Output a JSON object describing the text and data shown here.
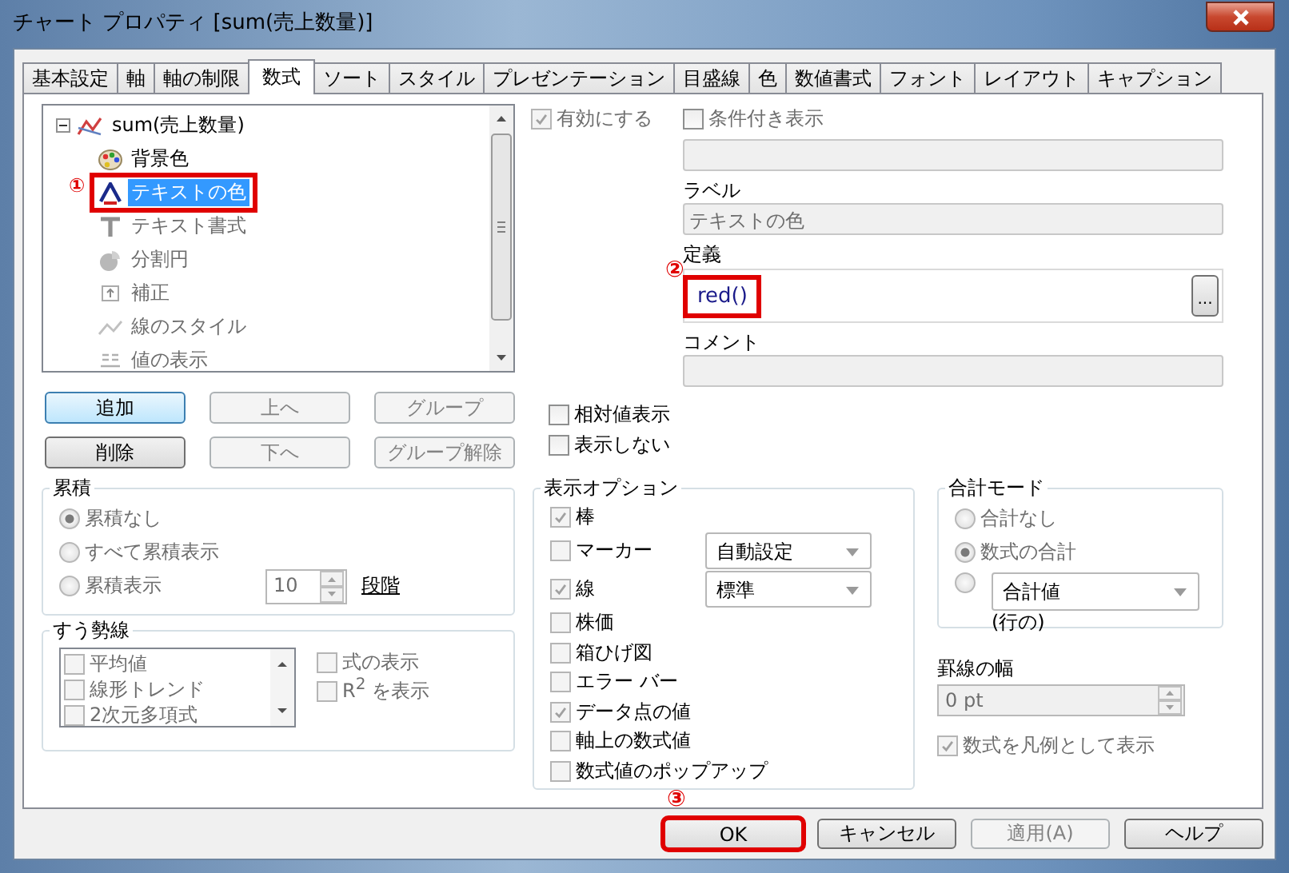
{
  "window": {
    "title": "チャート プロパティ [sum(売上数量)]"
  },
  "tabs": [
    {
      "label": "基本設定",
      "selected": false
    },
    {
      "label": "軸",
      "selected": false
    },
    {
      "label": "軸の制限",
      "selected": false
    },
    {
      "label": "数式",
      "selected": true
    },
    {
      "label": "ソート",
      "selected": false
    },
    {
      "label": "スタイル",
      "selected": false
    },
    {
      "label": "プレゼンテーション",
      "selected": false
    },
    {
      "label": "目盛線",
      "selected": false
    },
    {
      "label": "色",
      "selected": false
    },
    {
      "label": "数値書式",
      "selected": false
    },
    {
      "label": "フォント",
      "selected": false
    },
    {
      "label": "レイアウト",
      "selected": false
    },
    {
      "label": "キャプション",
      "selected": false
    }
  ],
  "expression_tree": {
    "items": [
      {
        "label": "sum(売上数量)",
        "expanded": true,
        "children": [
          {
            "label": "背景色",
            "selected": false,
            "disabled": false
          },
          {
            "label": "テキストの色",
            "selected": true,
            "disabled": false,
            "callout": "①"
          },
          {
            "label": "テキスト書式",
            "selected": false,
            "disabled": true
          },
          {
            "label": "分割円",
            "selected": false,
            "disabled": true
          },
          {
            "label": "補正",
            "selected": false,
            "disabled": true
          },
          {
            "label": "線のスタイル",
            "selected": false,
            "disabled": true
          },
          {
            "label": "値の表示",
            "selected": false,
            "disabled": true
          }
        ]
      }
    ]
  },
  "tree_buttons": [
    {
      "label": "追加",
      "disabled": false
    },
    {
      "label": "上へ",
      "disabled": true
    },
    {
      "label": "グループ",
      "disabled": true
    },
    {
      "label": "削除",
      "disabled": false
    },
    {
      "label": "下へ",
      "disabled": true
    },
    {
      "label": "グループ解除",
      "disabled": true
    }
  ],
  "enable": {
    "label": "有効にする",
    "checked": true
  },
  "conditional": {
    "label": "条件付き表示",
    "checked": false
  },
  "label_field": {
    "label": "ラベル",
    "value": "テキストの色"
  },
  "definition": {
    "label": "定義",
    "value": "red()",
    "callout": "②",
    "button": "..."
  },
  "comment": {
    "label": "コメント"
  },
  "relative": {
    "label": "相対値表示",
    "checked": false
  },
  "invisible": {
    "label": "表示しない",
    "checked": false
  },
  "accumulation": {
    "title": "累積",
    "options": [
      {
        "label": "累積なし",
        "selected": true
      },
      {
        "label": "すべて累積表示",
        "selected": false
      },
      {
        "label": "累積表示",
        "selected": false
      }
    ],
    "steps": {
      "value": "10",
      "label": "段階"
    }
  },
  "trendlines": {
    "title": "すう勢線",
    "items": [
      {
        "label": "平均値",
        "checked": false
      },
      {
        "label": "線形トレンド",
        "checked": false
      },
      {
        "label": "2次元多項式",
        "checked": false
      }
    ],
    "options": [
      {
        "label": "式の表示",
        "checked": false
      },
      {
        "label": "R$^{2}$ を表示",
        "checked": false
      }
    ]
  },
  "display_options": {
    "title": "表示オプション",
    "items": [
      {
        "label": "棒",
        "checked": true
      },
      {
        "label": "マーカー",
        "checked": false,
        "dropdown": "自動設定"
      },
      {
        "label": "線",
        "checked": true,
        "dropdown": "標準"
      },
      {
        "label": "株価",
        "checked": false
      },
      {
        "label": "箱ひげ図",
        "checked": false
      },
      {
        "label": "エラー バー",
        "checked": false
      },
      {
        "label": "データ点の値",
        "checked": true
      },
      {
        "label": "軸上の数式値",
        "checked": false
      },
      {
        "label": "数式値のポップアップ",
        "checked": false
      }
    ]
  },
  "total_mode": {
    "title": "合計モード",
    "options": [
      {
        "label": "合計なし",
        "selected": false
      },
      {
        "label": "数式の合計",
        "selected": true
      },
      {
        "dropdown": "合計値",
        "note": "(行の)",
        "selected": false
      }
    ]
  },
  "line_width": {
    "label": "罫線の幅",
    "value": "0 pt"
  },
  "legend": {
    "label": "数式を凡例として表示",
    "checked": true
  },
  "buttons": [
    {
      "label": "OK",
      "disabled": false,
      "callout": "③"
    },
    {
      "label": "キャンセル",
      "disabled": false
    },
    {
      "label": "適用(A)",
      "disabled": true
    },
    {
      "label": "ヘルプ",
      "disabled": false
    }
  ]
}
